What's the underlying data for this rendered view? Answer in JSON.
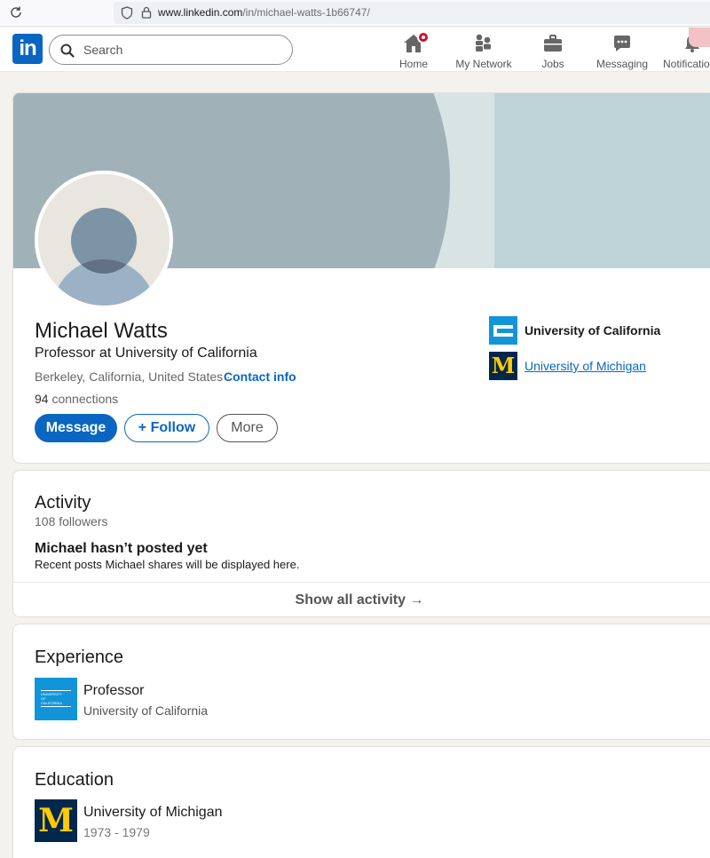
{
  "browser": {
    "url_domain": "www.linkedin.com",
    "url_path": "/in/michael-watts-1b66747/"
  },
  "nav": {
    "logo": "in",
    "search_placeholder": "Search",
    "items": [
      {
        "label": "Home",
        "icon": "home-icon"
      },
      {
        "label": "My Network",
        "icon": "network-icon"
      },
      {
        "label": "Jobs",
        "icon": "briefcase-icon"
      },
      {
        "label": "Messaging",
        "icon": "chat-icon"
      },
      {
        "label": "Notifications",
        "icon": "bell-icon"
      }
    ],
    "brand_color": "#0a66c2",
    "badge_color": "#cb112d"
  },
  "profile": {
    "name": "Michael Watts",
    "headline": "Professor at University of California",
    "location": "Berkeley, California, United States",
    "separator": "·",
    "contact_label": "Contact info",
    "connections_count": "94",
    "connections_label": "connections",
    "buttons": {
      "message": "Message",
      "follow": "Follow",
      "follow_prefix": "+",
      "more": "More"
    },
    "orgs": [
      {
        "name": "University of California",
        "icon": "uc-logo"
      },
      {
        "name": "University of Michigan",
        "icon": "um-logo",
        "logo_text": "M"
      }
    ]
  },
  "activity": {
    "title": "Activity",
    "followers": "108 followers",
    "empty_title": "Michael hasn’t posted yet",
    "empty_text": "Recent posts Michael shares will be displayed here.",
    "show_all": "Show all activity →"
  },
  "experience": {
    "title": "Experience",
    "items": [
      {
        "role": "Professor",
        "org": "University of California",
        "logo_lines": [
          "UNIVERSITY",
          "OF",
          "CALIFORNIA"
        ]
      }
    ]
  },
  "education": {
    "title": "Education",
    "items": [
      {
        "school": "University of Michigan",
        "years": "1973 - 1979",
        "logo_text": "M"
      }
    ]
  }
}
